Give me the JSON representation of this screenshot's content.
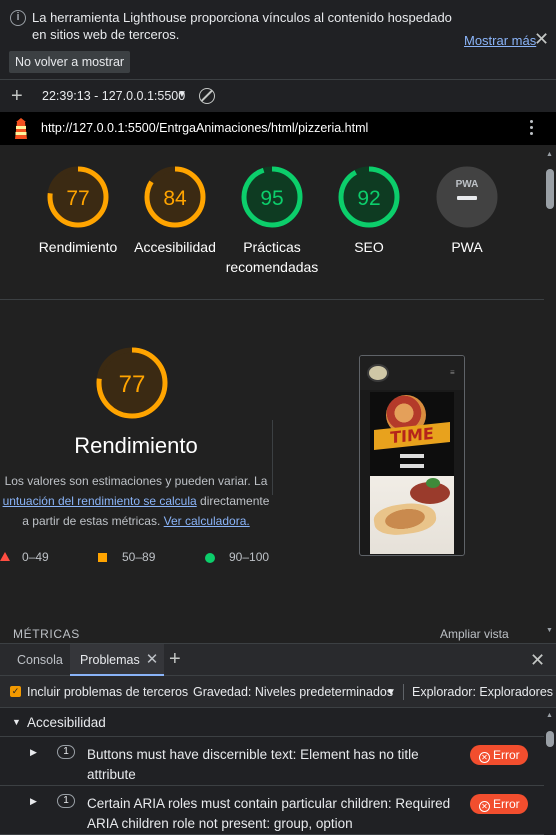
{
  "infobar": {
    "message": "La herramienta Lighthouse proporciona vínculos al contenido hospedado en sitios web de terceros.",
    "more_link": "Mostrar más",
    "dismiss_button": "No volver a mostrar"
  },
  "report_toolbar": {
    "selected_report": "22:39:13 - 127.0.0.1:5500"
  },
  "urlbar": {
    "url": "http://127.0.0.1:5500/EntrgaAnimaciones/html/pizzeria.html"
  },
  "scores": [
    {
      "value": "77",
      "label": "Rendimiento",
      "status": "average",
      "fraction": 0.77
    },
    {
      "value": "84",
      "label": "Accesibilidad",
      "status": "average",
      "fraction": 0.84
    },
    {
      "value": "95",
      "label": "Prácticas recomendadas",
      "status": "pass",
      "fraction": 0.95
    },
    {
      "value": "92",
      "label": "SEO",
      "status": "pass",
      "fraction": 0.92
    },
    {
      "value": "PWA",
      "label": "PWA",
      "status": "na",
      "fraction": 0
    }
  ],
  "colors": {
    "average": "#ffa400",
    "pass": "#0cce6b",
    "fail": "#ff4e42",
    "link": "#8ab4f8",
    "error_badge": "#f24e2e"
  },
  "performance": {
    "score": "77",
    "title": "Rendimiento",
    "desc_line1": "Los valores son estimaciones y pueden variar. La",
    "desc_link": "untuación del rendimiento se calcula",
    "desc_after_link": " directamente",
    "desc_line3a": "a partir de estas métricas. ",
    "desc_link2": "Ver calculadora.",
    "legend": [
      "0–49",
      "50–89",
      "90–100"
    ]
  },
  "preview": {
    "hero_text": "TIME"
  },
  "section": {
    "metrics_heading": "MÉTRICAS",
    "expand_view": "Ampliar vista"
  },
  "drawer": {
    "tabs": [
      "Consola",
      "Problemas"
    ]
  },
  "problems_toolbar": {
    "include_third_party": "Incluir problemas de terceros",
    "severity": "Gravedad: Niveles predeterminados",
    "browser": "Explorador: Exploradores pr"
  },
  "problems": {
    "category": "Accesibilidad",
    "issues": [
      {
        "count": "1",
        "text": "Buttons must have discernible text: Element has no title attribute",
        "badge": "Error"
      },
      {
        "count": "1",
        "text": "Certain ARIA roles must contain particular children: Required ARIA children role not present: group, option",
        "badge": "Error"
      }
    ]
  }
}
